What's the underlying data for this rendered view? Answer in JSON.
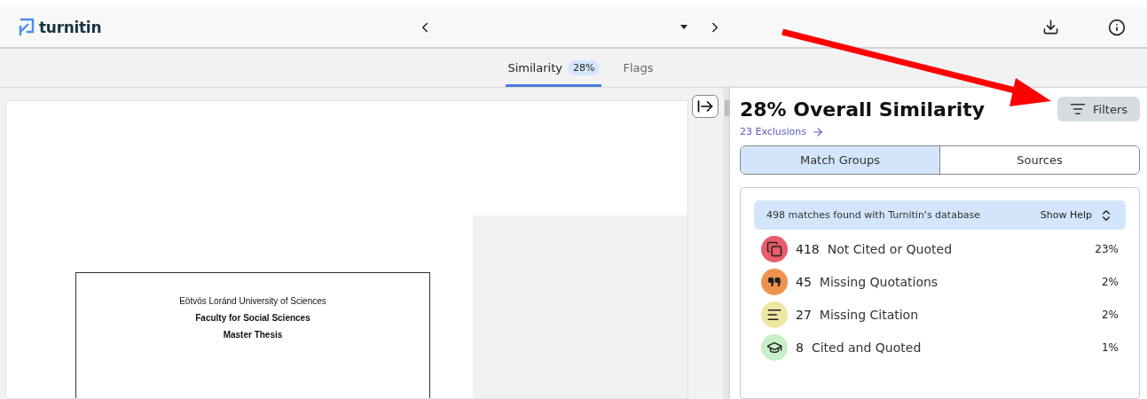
{
  "header": {
    "logo": "turnitin"
  },
  "tabs": [
    {
      "label": "Similarity",
      "badge": "28%",
      "selected": true
    },
    {
      "label": "Flags",
      "selected": false
    }
  ],
  "document": {
    "cover_lines": [
      {
        "text": "Eötvös Loránd University of Sciences",
        "bold": false
      },
      {
        "text": "Faculty for Social Sciences",
        "bold": true
      },
      {
        "text": "Master Thesis",
        "bold": true
      }
    ]
  },
  "panel": {
    "title": "28% Overall Similarity",
    "filters_button": "Filters",
    "exclusions_link": "23 Exclusions",
    "view_tabs": [
      {
        "label": "Match Groups",
        "selected": true
      },
      {
        "label": "Sources",
        "selected": false
      }
    ],
    "summary": {
      "text": "498 matches found with Turnitin's database",
      "help": "Show Help"
    },
    "groups": [
      {
        "kind": "copy",
        "color": "#e85c6c",
        "count": "418",
        "label": "Not Cited or Quoted",
        "percent": "23%"
      },
      {
        "kind": "quote",
        "color": "#ef924e",
        "count": "45",
        "label": "Missing Quotations",
        "percent": "2%"
      },
      {
        "kind": "lines",
        "color": "#efe6a4",
        "count": "27",
        "label": "Missing Citation",
        "percent": "2%"
      },
      {
        "kind": "cap",
        "color": "#c9efc9",
        "count": "8",
        "label": "Cited and Quoted",
        "percent": "1%"
      }
    ]
  }
}
